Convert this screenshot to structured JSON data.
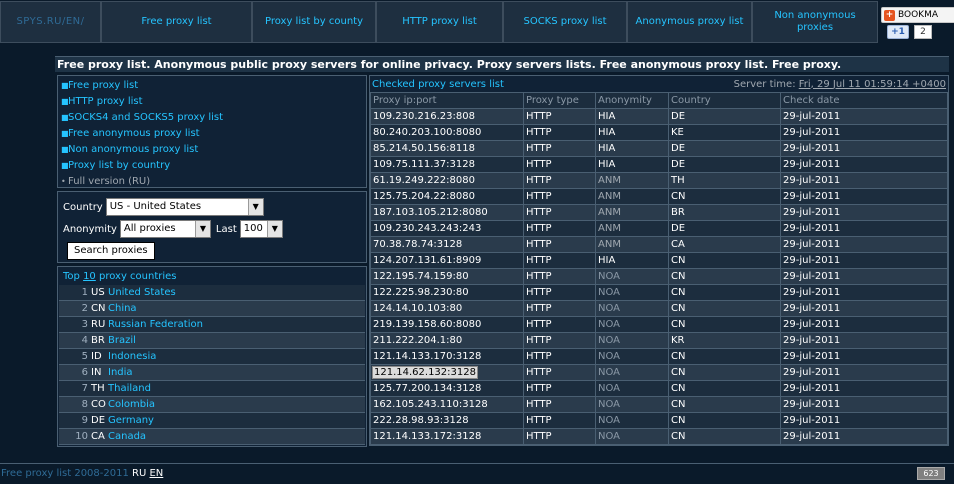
{
  "nav": {
    "items": [
      {
        "label": "SPYS.RU/EN/"
      },
      {
        "label": "Free proxy list"
      },
      {
        "label": "Proxy list by county"
      },
      {
        "label": "HTTP proxy list"
      },
      {
        "label": "SOCKS proxy list"
      },
      {
        "label": "Anonymous proxy list"
      },
      {
        "label": "Non anonymous proxies"
      }
    ],
    "bookmark_label": "BOOKMA",
    "gplus_label": "+1",
    "gplus_count": "2"
  },
  "page_title": "Free proxy list. Anonymous public proxy servers for online privacy. Proxy servers lists. Free anonymous proxy list. Free proxy.",
  "sidebar": {
    "links": [
      {
        "label": "Free proxy list"
      },
      {
        "label": "HTTP proxy list"
      },
      {
        "label": "SOCKS4 and SOCKS5 proxy list"
      },
      {
        "label": "Free anonymous proxy list"
      },
      {
        "label": "Non anonymous proxy list"
      },
      {
        "label": "Proxy list by country"
      },
      {
        "label": "Full version (RU)"
      }
    ]
  },
  "filter": {
    "country_label": "Country",
    "country_value": "US - United States",
    "anonymity_label": "Anonymity",
    "anonymity_value": "All proxies",
    "last_label": "Last",
    "last_value": "100",
    "search_button": "Search proxies"
  },
  "top_countries": {
    "prefix": "Top ",
    "count": "10",
    "suffix": " proxy countries",
    "rows": [
      {
        "num": "1",
        "code": "US",
        "name": "United States"
      },
      {
        "num": "2",
        "code": "CN",
        "name": "China"
      },
      {
        "num": "3",
        "code": "RU",
        "name": "Russian Federation"
      },
      {
        "num": "4",
        "code": "BR",
        "name": "Brazil"
      },
      {
        "num": "5",
        "code": "ID",
        "name": "Indonesia"
      },
      {
        "num": "6",
        "code": "IN",
        "name": "India"
      },
      {
        "num": "7",
        "code": "TH",
        "name": "Thailand"
      },
      {
        "num": "8",
        "code": "CO",
        "name": "Colombia"
      },
      {
        "num": "9",
        "code": "DE",
        "name": "Germany"
      },
      {
        "num": "10",
        "code": "CA",
        "name": "Canada"
      }
    ]
  },
  "proxy_table": {
    "title": "Checked proxy servers list",
    "server_time_label": "Server time: ",
    "server_time": "Fri, 29 Jul 11 01:59:14 +0400",
    "headers": [
      "Proxy ip:port",
      "Proxy type",
      "Anonymity",
      "Country",
      "Check date"
    ],
    "rows": [
      [
        "109.230.216.23:808",
        "HTTP",
        "HIA",
        "DE",
        "29-jul-2011"
      ],
      [
        "80.240.203.100:8080",
        "HTTP",
        "HIA",
        "KE",
        "29-jul-2011"
      ],
      [
        "85.214.50.156:8118",
        "HTTP",
        "HIA",
        "DE",
        "29-jul-2011"
      ],
      [
        "109.75.111.37:3128",
        "HTTP",
        "HIA",
        "DE",
        "29-jul-2011"
      ],
      [
        "61.19.249.222:8080",
        "HTTP",
        "ANM",
        "TH",
        "29-jul-2011"
      ],
      [
        "125.75.204.22:8080",
        "HTTP",
        "ANM",
        "CN",
        "29-jul-2011"
      ],
      [
        "187.103.105.212:8080",
        "HTTP",
        "ANM",
        "BR",
        "29-jul-2011"
      ],
      [
        "109.230.243.243:243",
        "HTTP",
        "ANM",
        "DE",
        "29-jul-2011"
      ],
      [
        "70.38.78.74:3128",
        "HTTP",
        "ANM",
        "CA",
        "29-jul-2011"
      ],
      [
        "124.207.131.61:8909",
        "HTTP",
        "HIA",
        "CN",
        "29-jul-2011"
      ],
      [
        "122.195.74.159:80",
        "HTTP",
        "NOA",
        "CN",
        "29-jul-2011"
      ],
      [
        "122.225.98.230:80",
        "HTTP",
        "NOA",
        "CN",
        "29-jul-2011"
      ],
      [
        "124.14.10.103:80",
        "HTTP",
        "NOA",
        "CN",
        "29-jul-2011"
      ],
      [
        "219.139.158.60:8080",
        "HTTP",
        "NOA",
        "CN",
        "29-jul-2011"
      ],
      [
        "211.222.204.1:80",
        "HTTP",
        "NOA",
        "KR",
        "29-jul-2011"
      ],
      [
        "121.14.133.170:3128",
        "HTTP",
        "NOA",
        "CN",
        "29-jul-2011"
      ],
      [
        "121.14.62.132:3128",
        "HTTP",
        "NOA",
        "CN",
        "29-jul-2011"
      ],
      [
        "125.77.200.134:3128",
        "HTTP",
        "NOA",
        "CN",
        "29-jul-2011"
      ],
      [
        "162.105.243.110:3128",
        "HTTP",
        "NOA",
        "CN",
        "29-jul-2011"
      ],
      [
        "222.28.98.93:3128",
        "HTTP",
        "NOA",
        "CN",
        "29-jul-2011"
      ],
      [
        "121.14.133.172:3128",
        "HTTP",
        "NOA",
        "CN",
        "29-jul-2011"
      ]
    ],
    "selected_row": 16
  },
  "footer": {
    "text": "Free proxy list 2008-2011 ",
    "lang_ru": "RU",
    "lang_en": "EN",
    "counter": "623"
  }
}
